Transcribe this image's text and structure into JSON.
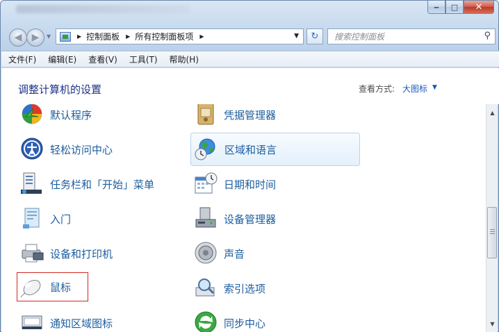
{
  "window": {
    "caption_buttons": [
      "minimize",
      "maximize",
      "close"
    ]
  },
  "nav": {
    "breadcrumbs": [
      "控制面板",
      "所有控制面板项"
    ],
    "search_placeholder": "搜索控制面板"
  },
  "menu": {
    "items": [
      "文件(F)",
      "编辑(E)",
      "查看(V)",
      "工具(T)",
      "帮助(H)"
    ]
  },
  "header": {
    "title": "调整计算机的设置",
    "view_label": "查看方式:",
    "view_value": "大图标"
  },
  "items": {
    "left": [
      {
        "label": "默认程序",
        "icon": "default-programs-icon"
      },
      {
        "label": "轻松访问中心",
        "icon": "ease-of-access-icon"
      },
      {
        "label": "任务栏和「开始」菜单",
        "icon": "taskbar-start-menu-icon"
      },
      {
        "label": "入门",
        "icon": "getting-started-icon"
      },
      {
        "label": "设备和打印机",
        "icon": "devices-printers-icon"
      },
      {
        "label": "鼠标",
        "icon": "mouse-icon",
        "highlighted_box": true
      },
      {
        "label": "通知区域图标",
        "icon": "notification-area-icon"
      }
    ],
    "right": [
      {
        "label": "凭据管理器",
        "icon": "credential-manager-icon"
      },
      {
        "label": "区域和语言",
        "icon": "region-language-icon",
        "hovered": true
      },
      {
        "label": "日期和时间",
        "icon": "date-time-icon"
      },
      {
        "label": "设备管理器",
        "icon": "device-manager-icon"
      },
      {
        "label": "声音",
        "icon": "sound-icon"
      },
      {
        "label": "索引选项",
        "icon": "indexing-options-icon"
      },
      {
        "label": "同步中心",
        "icon": "sync-center-icon"
      }
    ]
  },
  "colors": {
    "item_label": "#1c5d9e",
    "title": "#1e3287",
    "highlight_box": "#d0281e",
    "hover_border": "#b6d3ef"
  }
}
